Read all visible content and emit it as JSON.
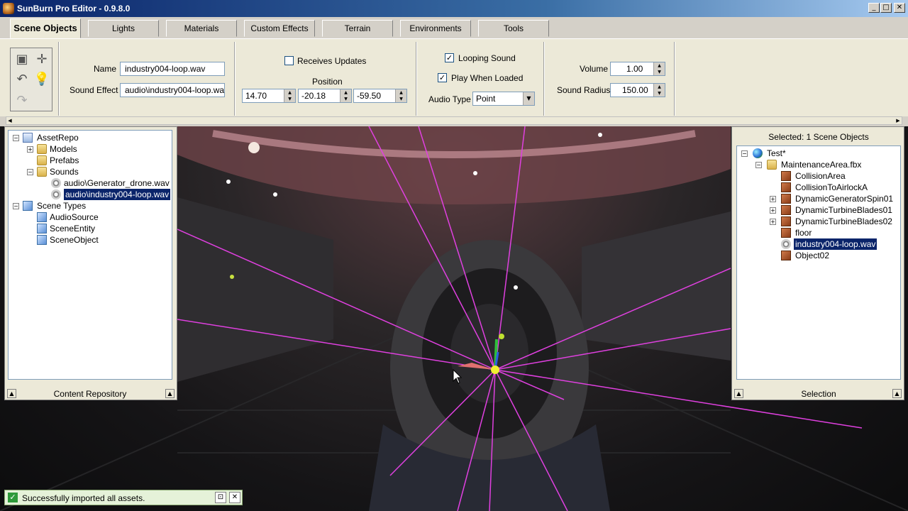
{
  "window": {
    "title": "SunBurn Pro Editor - 0.9.8.0",
    "buttons": {
      "minimize": "_",
      "maximize": "□",
      "close": "✕"
    }
  },
  "tabs": [
    "Scene Objects",
    "Lights",
    "Materials",
    "Custom Effects",
    "Terrain",
    "Environments",
    "Tools"
  ],
  "properties": {
    "name_label": "Name",
    "name_value": "industry004-loop.wav",
    "sound_effect_label": "Sound Effect",
    "sound_effect_value": "audio\\industry004-loop.wav",
    "receives_updates_label": "Receives Updates",
    "receives_updates_checked": false,
    "position_label": "Position",
    "position_x": "14.70",
    "position_y": "-20.18",
    "position_z": "-59.50",
    "looping_sound_label": "Looping Sound",
    "looping_sound_checked": true,
    "play_when_loaded_label": "Play When Loaded",
    "play_when_loaded_checked": true,
    "audio_type_label": "Audio Type",
    "audio_type_value": "Point",
    "volume_label": "Volume",
    "volume_value": "1.00",
    "sound_radius_label": "Sound Radius",
    "sound_radius_value": "150.00"
  },
  "content_repository": {
    "footer": "Content Repository",
    "tree": {
      "root": "AssetRepo",
      "models": "Models",
      "prefabs": "Prefabs",
      "sounds": "Sounds",
      "sound1": "audio\\Generator_drone.wav",
      "sound2": "audio\\industry004-loop.wav",
      "scene_types": "Scene Types",
      "type1": "AudioSource",
      "type2": "SceneEntity",
      "type3": "SceneObject"
    }
  },
  "selection": {
    "header": "Selected: 1 Scene Objects",
    "footer": "Selection",
    "tree": {
      "root": "Test*",
      "file": "MaintenanceArea.fbx",
      "items": [
        "CollisionArea",
        "CollisionToAirlockA",
        "DynamicGeneratorSpin01",
        "DynamicTurbineBlades01",
        "DynamicTurbineBlades02",
        "floor",
        "industry004-loop.wav",
        "Object02"
      ]
    }
  },
  "status": {
    "message": "Successfully imported all assets."
  },
  "colors": {
    "gizmo_lines": "#e040e0",
    "selection_bg": "#0a246a"
  }
}
